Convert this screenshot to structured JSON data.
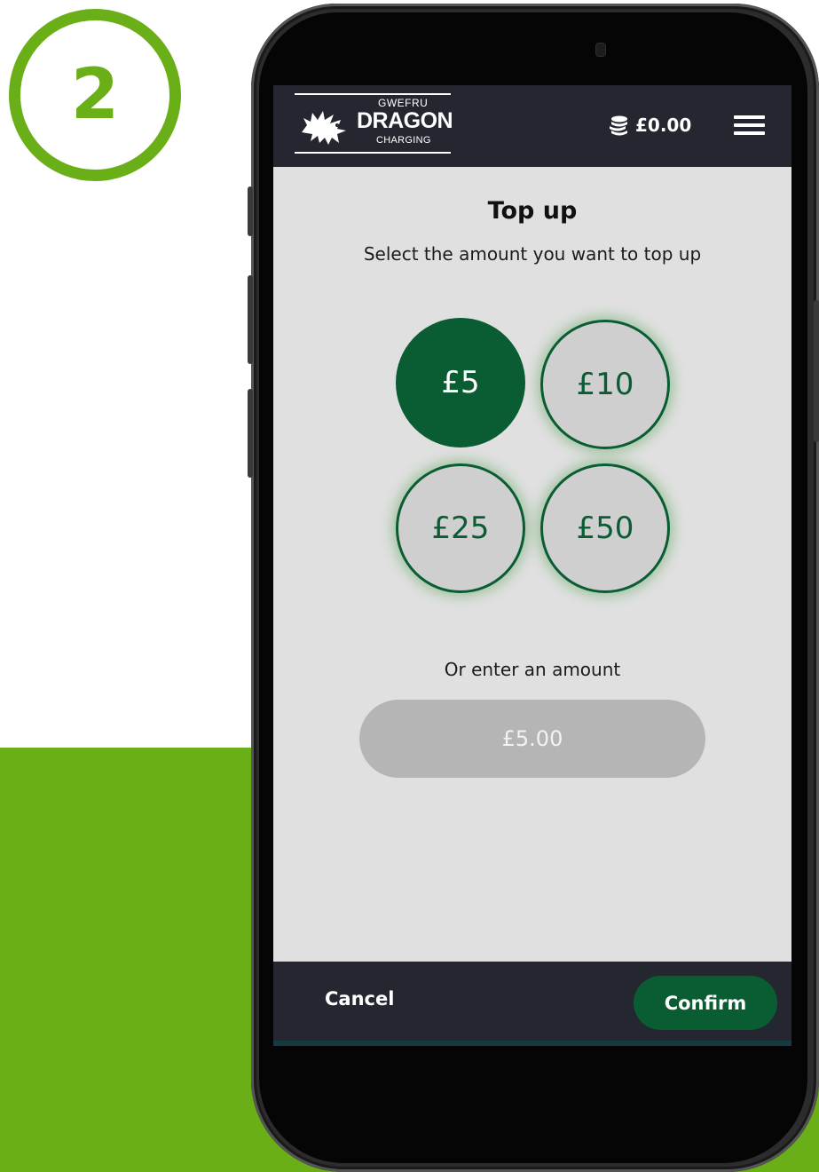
{
  "step": {
    "number": "2"
  },
  "header": {
    "logo": {
      "top": "GWEFRU",
      "main": "DRAGON",
      "bottom": "CHARGING"
    },
    "balance": "£0.00",
    "balance_icon": "coins-icon",
    "menu_icon": "hamburger-menu-icon"
  },
  "main": {
    "title": "Top up",
    "subtitle": "Select the amount you want to top up",
    "amounts": [
      {
        "label": "£5",
        "selected": true
      },
      {
        "label": "£10",
        "selected": false
      },
      {
        "label": "£25",
        "selected": false
      },
      {
        "label": "£50",
        "selected": false
      }
    ],
    "custom_label": "Or enter an amount",
    "custom_placeholder": "£5.00"
  },
  "footer": {
    "cancel_label": "Cancel",
    "confirm_label": "Confirm"
  },
  "colors": {
    "accent_green": "#6aaf17",
    "brand_dark_green": "#0a5d33",
    "header_bg": "#242730",
    "screen_bg": "#e0e0e0"
  }
}
